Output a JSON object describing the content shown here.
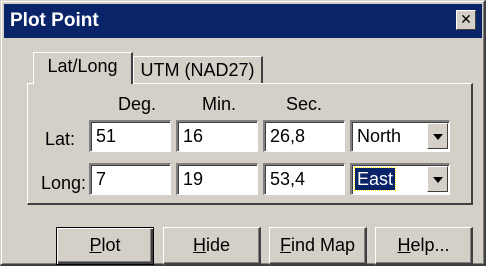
{
  "window": {
    "title": "Plot Point",
    "close_glyph": "✕"
  },
  "tabs": [
    {
      "label": "Lat/Long",
      "active": true
    },
    {
      "label": "UTM (NAD27)",
      "active": false
    }
  ],
  "columns": {
    "deg": "Deg.",
    "min": "Min.",
    "sec": "Sec."
  },
  "lat": {
    "label": "Lat:",
    "deg": "51",
    "min": "16",
    "sec": "26,8",
    "hemisphere": "North"
  },
  "long": {
    "label": "Long:",
    "deg": "7",
    "min": "19",
    "sec": "53,4",
    "hemisphere": "East"
  },
  "buttons": {
    "plot": {
      "access": "P",
      "rest": "lot"
    },
    "hide": {
      "access": "H",
      "rest": "ide"
    },
    "find_map": {
      "access": "F",
      "rest": "ind Map"
    },
    "help": {
      "access": "H",
      "rest": "elp..."
    }
  },
  "colors": {
    "titlebar": "#0a246a",
    "face": "#d4d0c8",
    "selection": "#0a246a"
  }
}
